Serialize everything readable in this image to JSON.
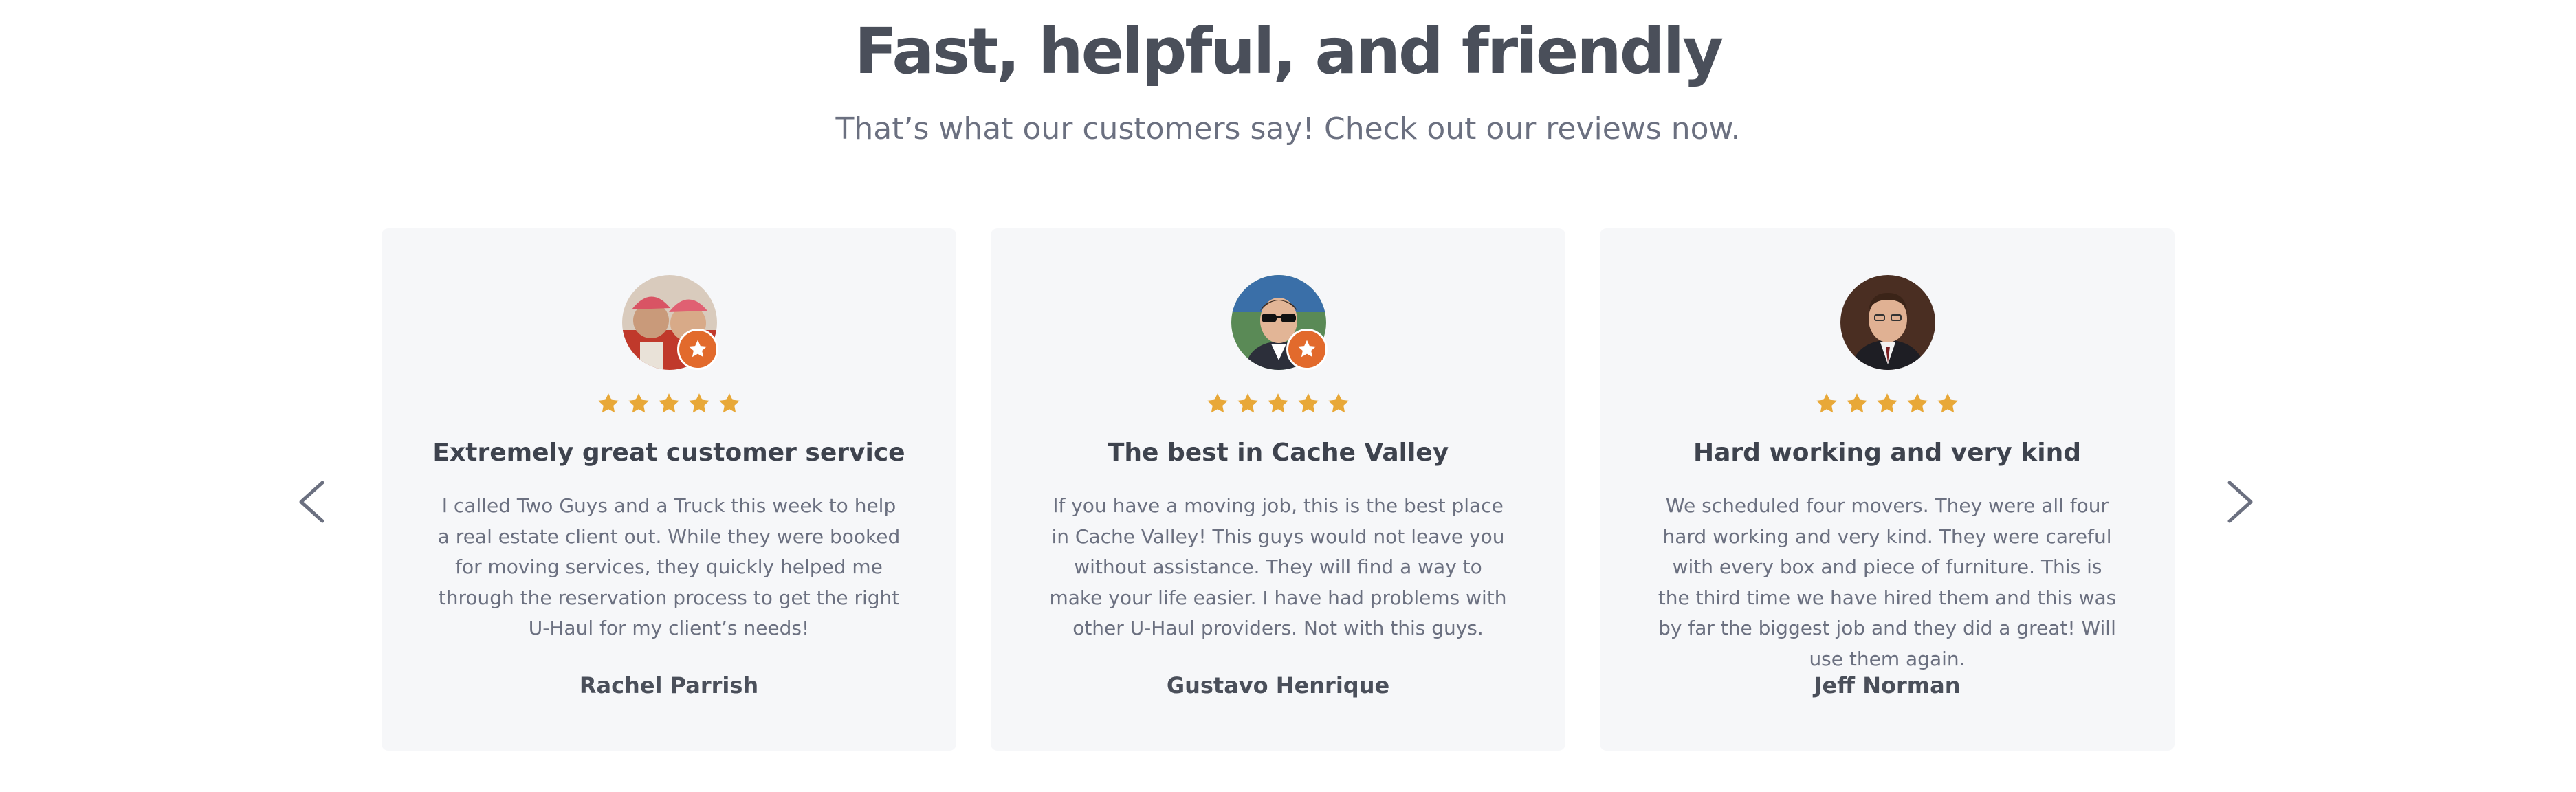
{
  "header": {
    "title": "Fast, helpful, and friendly",
    "subtitle": "That’s what our customers say! Check out our reviews now."
  },
  "carousel": {
    "prev_icon": "chevron-left-icon",
    "next_icon": "chevron-right-icon",
    "reviews": [
      {
        "title": "Extremely great customer service",
        "body": "I called Two Guys and a Truck this week to help a real estate client out. While they were booked for moving services, they quickly helped me through the reservation process to get the right U-Haul for my client’s needs!",
        "name": "Rachel Parrish",
        "rating": 5,
        "has_badge": true
      },
      {
        "title": "The best in Cache Valley",
        "body": "If you have a moving job, this is the best place in Cache Valley! This guys would not leave you without assistance. They will find a way to make your life easier. I have had problems with other U-Haul providers. Not with this guys.",
        "name": "Gustavo Henrique",
        "rating": 5,
        "has_badge": true
      },
      {
        "title": "Hard working and very kind",
        "body": "We scheduled four movers. They were all four hard working and very kind. They were careful with every box and piece of furniture. This is the third time we have hired them and this was by far the biggest job and they did a great! Will use them again.",
        "name": "Jeff Norman",
        "rating": 5,
        "has_badge": false
      }
    ]
  },
  "colors": {
    "heading": "#4a4f5a",
    "body_text": "#6b7080",
    "card_background": "#f6f7f9",
    "star": "#e8a838",
    "badge": "#e26a2c",
    "arrow": "#6b7080"
  }
}
